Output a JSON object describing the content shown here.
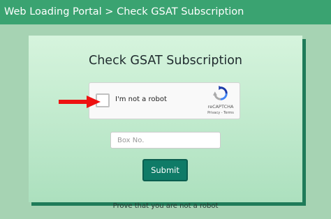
{
  "header": {
    "breadcrumb": "Web Loading Portal > Check GSAT Subscription"
  },
  "page": {
    "title": "Check GSAT Subscription",
    "footer_note": "Prove that you are not a robot"
  },
  "recaptcha": {
    "label": "I'm not a robot",
    "brand": "reCAPTCHA",
    "links": "Privacy - Terms",
    "logo_icon": "recaptcha-logo-icon",
    "checked": false
  },
  "form": {
    "box_no_placeholder": "Box No.",
    "box_no_value": "",
    "submit_label": "Submit"
  },
  "annotation": {
    "arrow_icon": "red-arrow-icon",
    "arrow_color": "#ee1111"
  },
  "colors": {
    "header_bg": "#3aa371",
    "page_bg": "#a6d3b3",
    "button_bg": "#0f7b67"
  }
}
